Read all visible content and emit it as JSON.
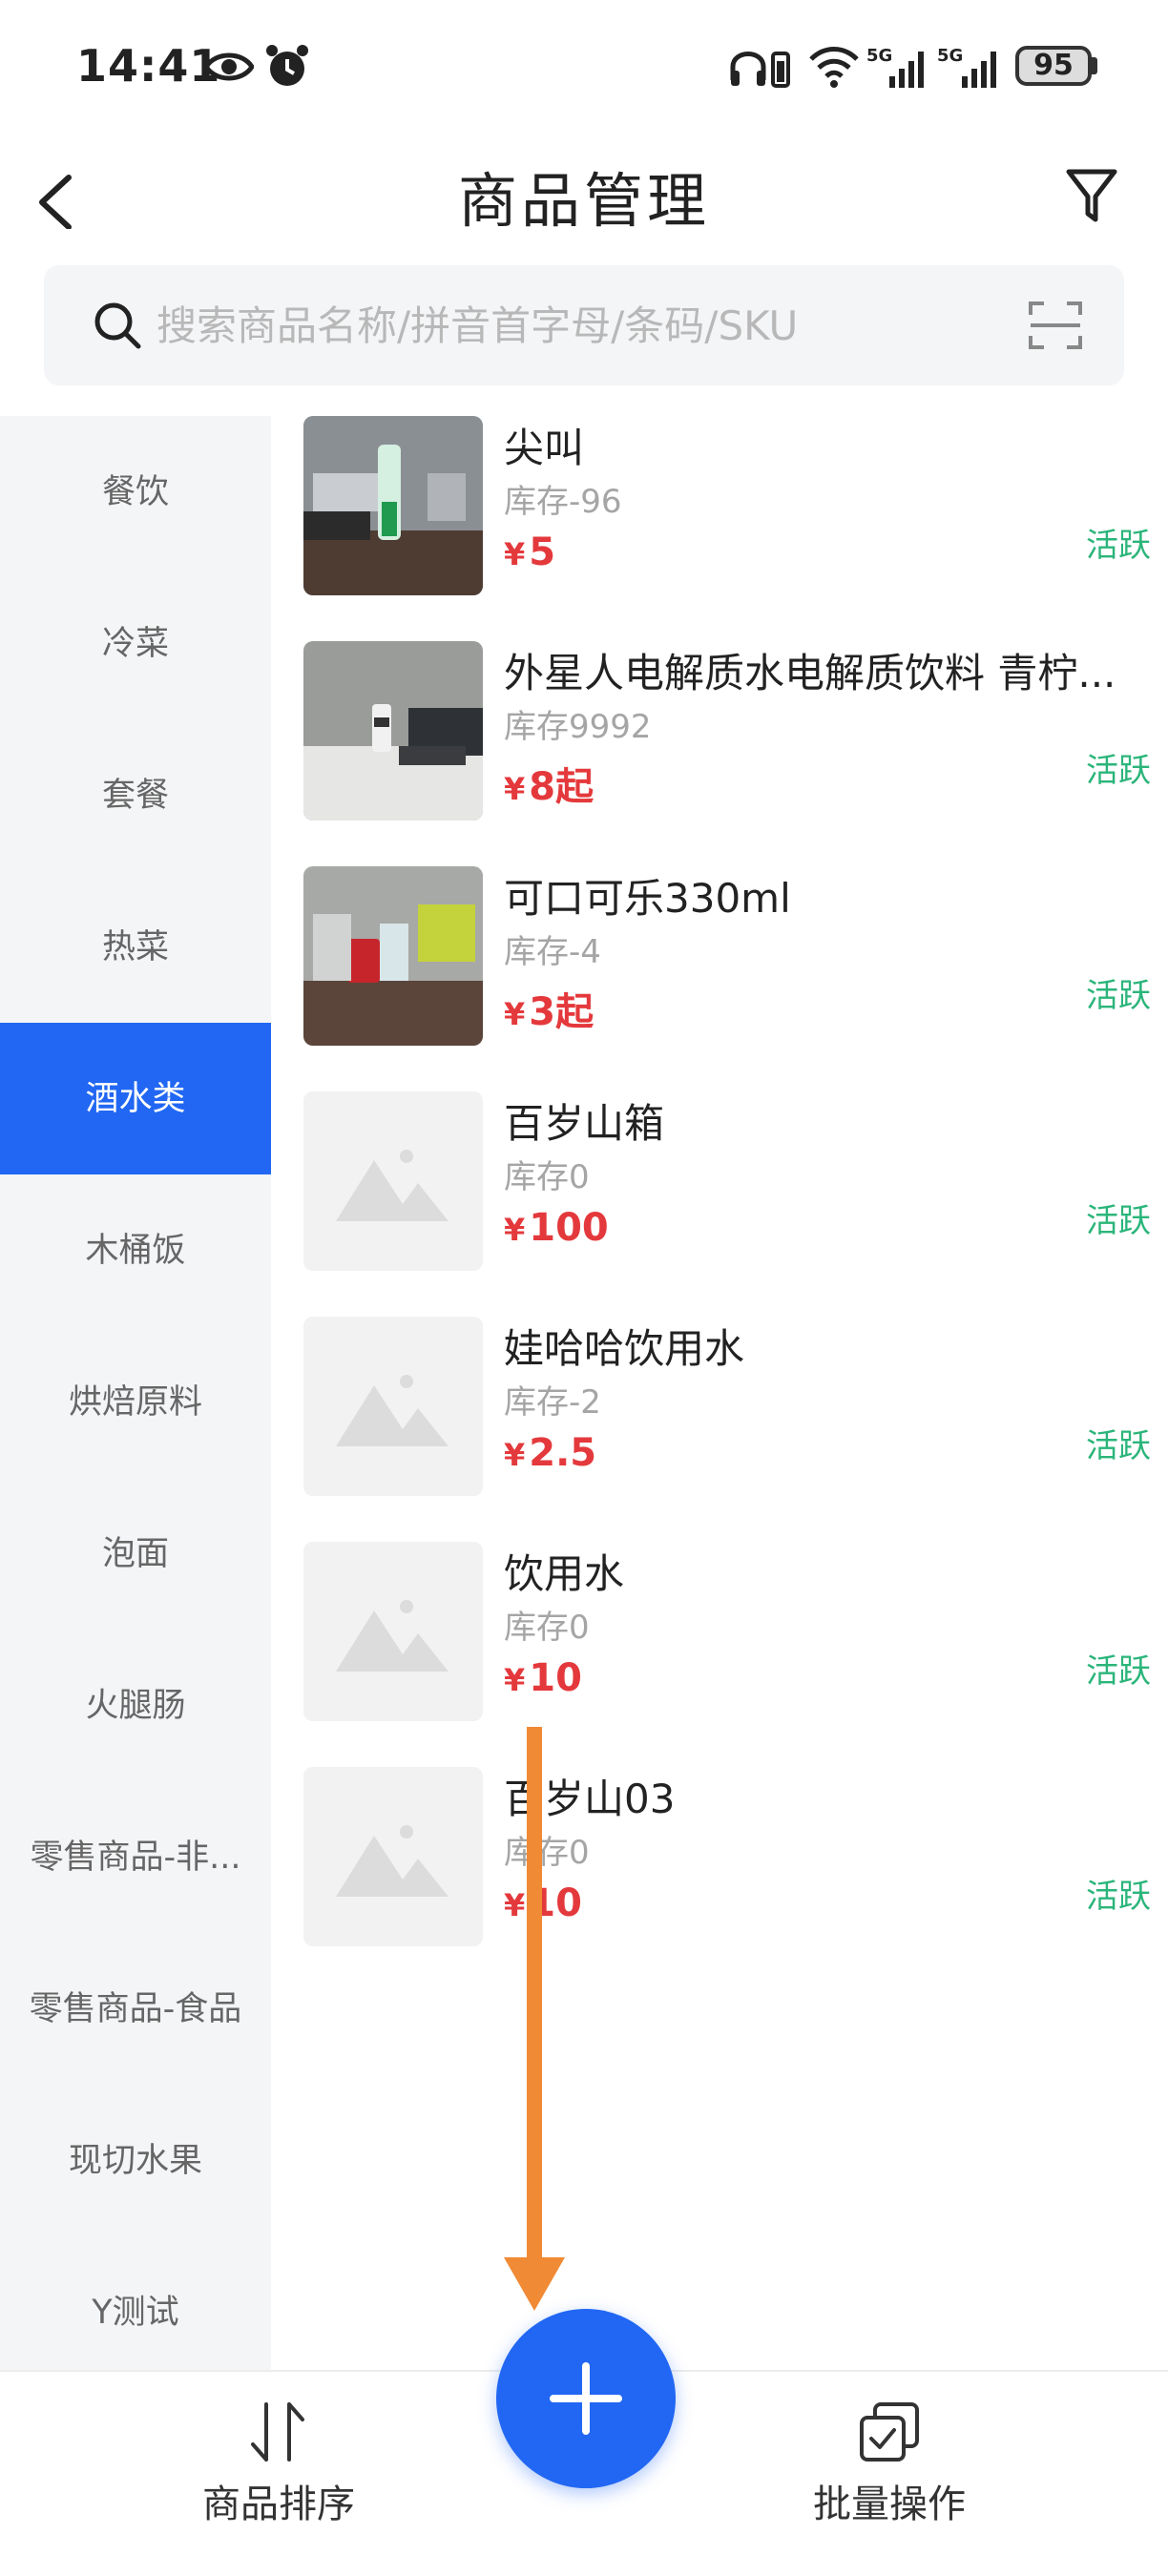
{
  "status_bar": {
    "time": "14:41",
    "battery": "95",
    "icons": [
      "eye-icon",
      "alarm-icon",
      "headphones-icon",
      "wifi-icon",
      "signal-5g-icon",
      "signal-5g-icon",
      "battery-icon"
    ]
  },
  "header": {
    "title": "商品管理",
    "back_icon": "chevron-left-icon",
    "filter_icon": "filter-icon"
  },
  "search": {
    "placeholder": "搜索商品名称/拼音首字母/条码/SKU",
    "icon": "search-icon",
    "scan_icon": "scan-icon"
  },
  "sidebar": {
    "active_index": 4,
    "items": [
      {
        "label": "餐饮"
      },
      {
        "label": "冷菜"
      },
      {
        "label": "套餐"
      },
      {
        "label": "热菜"
      },
      {
        "label": "酒水类"
      },
      {
        "label": "木桶饭"
      },
      {
        "label": "烘焙原料"
      },
      {
        "label": "泡面"
      },
      {
        "label": "火腿肠"
      },
      {
        "label": "零售商品-非..."
      },
      {
        "label": "零售商品-食品"
      },
      {
        "label": "现切水果"
      },
      {
        "label": "Y测试"
      }
    ]
  },
  "products": [
    {
      "name": "尖叫",
      "stock": "库存-96",
      "currency": "¥",
      "price": "5",
      "status": "活跃",
      "image": "photo"
    },
    {
      "name": "外星人电解质水电解质饮料 青柠...",
      "stock": "库存9992",
      "currency": "¥",
      "price": "8起",
      "status": "活跃",
      "image": "photo"
    },
    {
      "name": "可口可乐330ml",
      "stock": "库存-4",
      "currency": "¥",
      "price": "3起",
      "status": "活跃",
      "image": "photo"
    },
    {
      "name": "百岁山箱",
      "stock": "库存0",
      "currency": "¥",
      "price": "100",
      "status": "活跃",
      "image": "placeholder"
    },
    {
      "name": "娃哈哈饮用水",
      "stock": "库存-2",
      "currency": "¥",
      "price": "2.5",
      "status": "活跃",
      "image": "placeholder"
    },
    {
      "name": "饮用水",
      "stock": "库存0",
      "currency": "¥",
      "price": "10",
      "status": "活跃",
      "image": "placeholder"
    },
    {
      "name": "百岁山03",
      "stock": "库存0",
      "currency": "¥",
      "price": "10",
      "status": "活跃",
      "image": "placeholder"
    }
  ],
  "bottom_bar": {
    "sort_label": "商品排序",
    "batch_label": "批量操作",
    "add_icon": "plus-icon"
  },
  "colors": {
    "accent": "#2167f3",
    "price": "#e4393c",
    "status": "#2bb57a",
    "annotation_arrow": "#f08a35"
  }
}
